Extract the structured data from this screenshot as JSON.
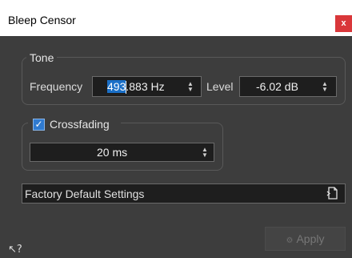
{
  "window": {
    "title": "Bleep Censor",
    "close_glyph": "x"
  },
  "tone": {
    "legend": "Tone",
    "frequency_label": "Frequency",
    "frequency_selected": "493",
    "frequency_rest": ".883 Hz",
    "level_label": "Level",
    "level_value": "-6.02 dB"
  },
  "crossfading": {
    "label": "Crossfading",
    "checked": true,
    "value": "20 ms"
  },
  "preset": {
    "label": "Factory Default Settings",
    "icon": "preset-menu-icon"
  },
  "footer": {
    "apply_label": "Apply",
    "apply_icon": "apply-icon",
    "help_icon": "whats-this-help-icon"
  },
  "colors": {
    "accent": "#1a6fc7",
    "close": "#d9373a",
    "background": "#3d3d3d"
  }
}
